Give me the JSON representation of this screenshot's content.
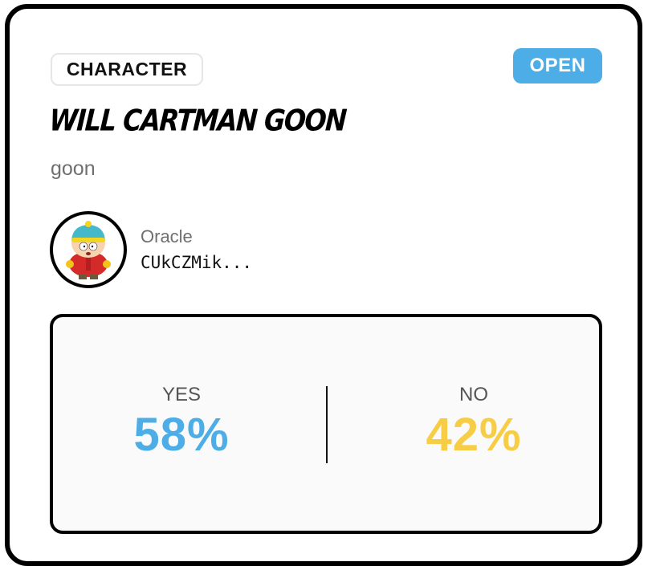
{
  "market": {
    "category": "CHARACTER",
    "status": "OPEN",
    "title": "Will Cartman Goon",
    "description": "goon",
    "oracle": {
      "label": "Oracle",
      "address": "CUkCZMik..."
    },
    "odds": {
      "yes_label": "YES",
      "yes_value": "58%",
      "no_label": "NO",
      "no_value": "42%"
    }
  },
  "colors": {
    "yes": "#4dade6",
    "no": "#f6cd44",
    "status_badge": "#4dade6"
  },
  "icons": {
    "avatar": "cartman-avatar"
  }
}
